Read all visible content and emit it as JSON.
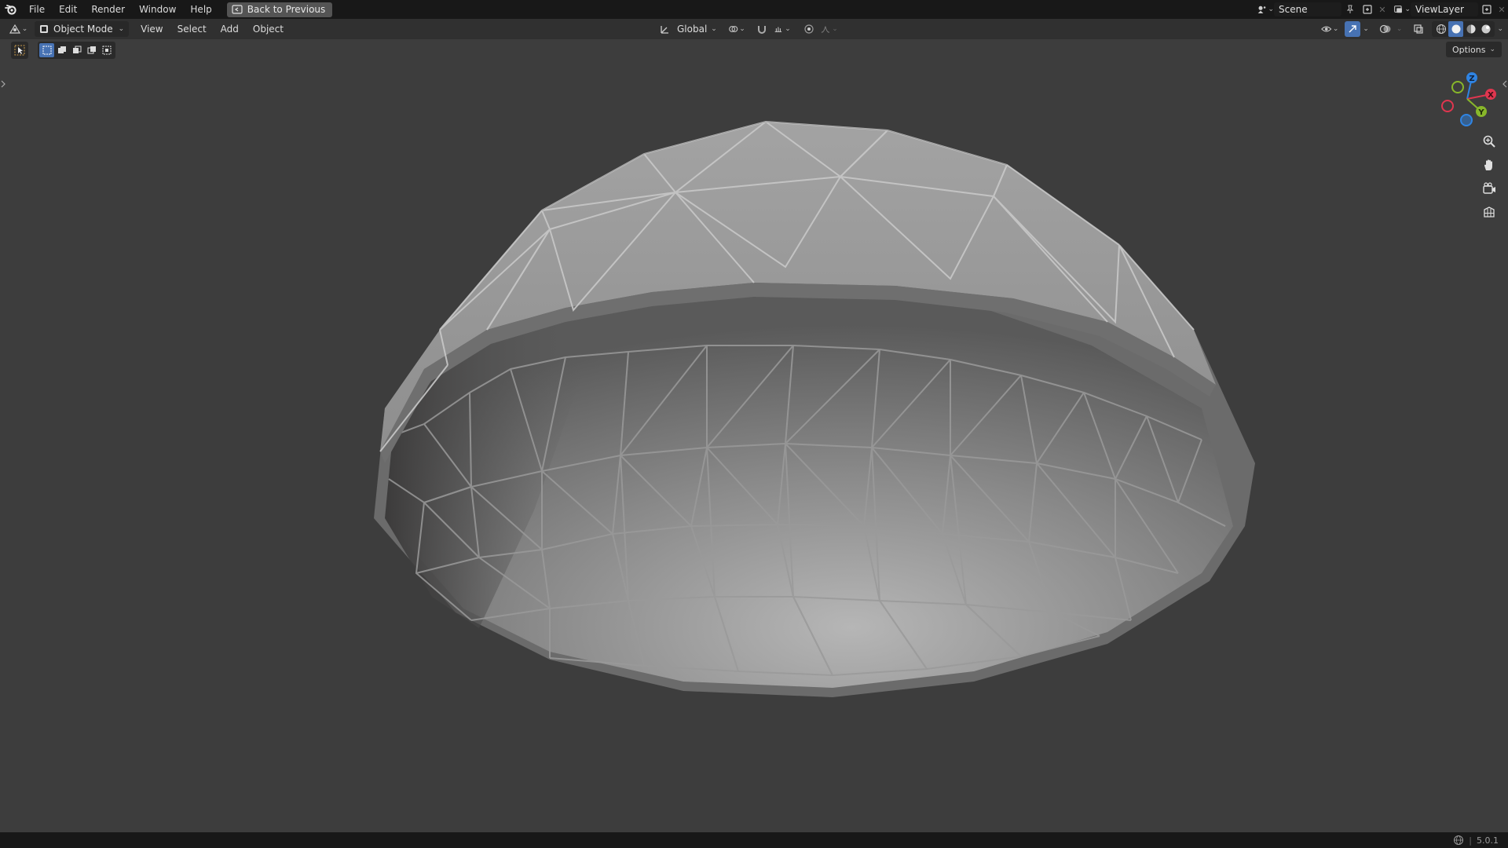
{
  "topbar": {
    "menus": [
      "File",
      "Edit",
      "Render",
      "Window",
      "Help"
    ],
    "back_label": "Back to Previous",
    "scene_name": "Scene",
    "view_layer": "ViewLayer"
  },
  "header": {
    "mode": "Object Mode",
    "menus": [
      "View",
      "Select",
      "Add",
      "Object"
    ],
    "transform_orientation": "Global"
  },
  "options_label": "Options",
  "gizmo": {
    "z": "Z",
    "x": "X",
    "y": "Y"
  },
  "status": {
    "version": "5.0.1"
  },
  "colors": {
    "accent": "#4772b3",
    "axis_x": "#e0364f",
    "axis_y": "#88b72a",
    "axis_z": "#2f84e3"
  }
}
